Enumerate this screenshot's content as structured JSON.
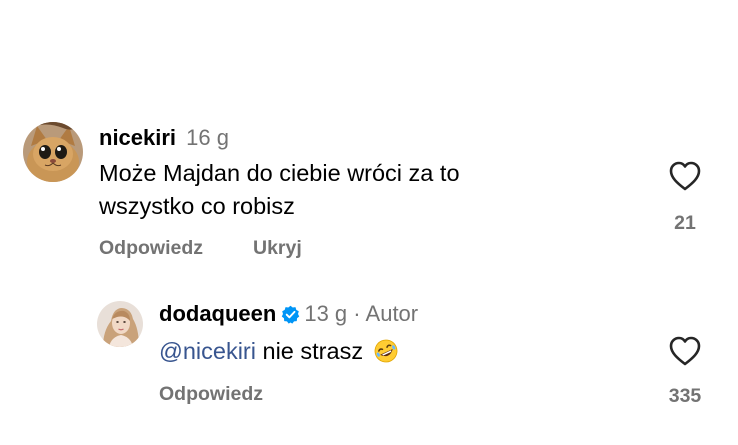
{
  "colors": {
    "text": "#000000",
    "secondary": "#737373",
    "mention": "#38558f",
    "verified": "#0095f6"
  },
  "comments": [
    {
      "username": "nicekiri",
      "time": "16 g",
      "text_line1": "Może Majdan do ciebie wróci za to",
      "text_line2": "wszystko co robisz",
      "reply_label": "Odpowiedz",
      "hide_label": "Ukryj",
      "likes": "21",
      "avatar_icon": "cat-avatar-icon",
      "like_icon": "heart-outline-icon"
    }
  ],
  "replies": [
    {
      "username": "dodaqueen",
      "verified": true,
      "verified_icon": "verified-badge-icon",
      "time": "13 g",
      "separator": "·",
      "author_tag": "Autor",
      "mention": "@nicekiri",
      "text": " nie strasz",
      "emoji": "rolling-on-floor-laughing-emoji",
      "reply_label": "Odpowiedz",
      "likes": "335",
      "avatar_icon": "user-avatar-icon",
      "like_icon": "heart-outline-icon"
    }
  ]
}
